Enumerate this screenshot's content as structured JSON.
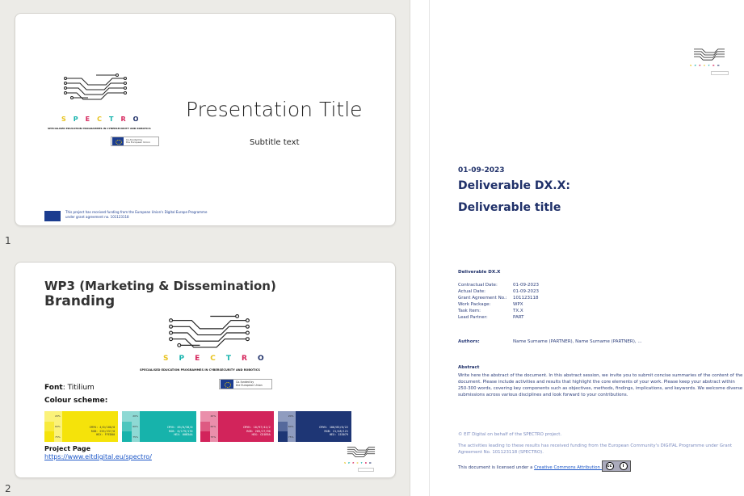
{
  "brand": {
    "letters": [
      {
        "ch": "S",
        "color": "#e8c31e"
      },
      {
        "ch": "P",
        "color": "#16b3ad"
      },
      {
        "ch": "E",
        "color": "#d6265c"
      },
      {
        "ch": "C",
        "color": "#e8c31e"
      },
      {
        "ch": "T",
        "color": "#16b3ad"
      },
      {
        "ch": "R",
        "color": "#d6265c"
      },
      {
        "ch": "O",
        "color": "#1f3069"
      }
    ],
    "tagline": "SPECIALISED EDUCATION PROGRAMMES IN CYBERSECURITY AND ROBOTICS",
    "eu_line1": "Co-funded by",
    "eu_line2": "the European Union"
  },
  "slides": [
    {
      "number": "1",
      "title": "Presentation Title",
      "subtitle": "Subtitle text",
      "footer_line1": "This project has received funding from the European Union's Digital Europe Programme",
      "footer_line2": "under grant agreement no. 101123118"
    },
    {
      "number": "2",
      "title_line1": "WP3 (Marketing & Dissemination)",
      "title_line2": "Branding",
      "font_label": "Font",
      "font_value": ": Titilium",
      "colour_label": "Colour scheme:",
      "swatches": [
        {
          "main": "#f5e30a",
          "tints": [
            "#fbf27a",
            "#f8ea3c",
            "#f5e30a"
          ],
          "text": "#333333",
          "cmyk": "CMYK: 4/0/100/0",
          "rgb": "RGB: 255/237/0",
          "hex": "HEX: FFED00"
        },
        {
          "main": "#17b3ab",
          "tints": [
            "#8ed9d4",
            "#4fc6be",
            "#17b3ab"
          ],
          "text": "#ffffff",
          "cmyk": "CMYK: 85/0/38/0",
          "rgb": "RGB: 0/179/170",
          "hex": "HEX: 00B3AA"
        },
        {
          "main": "#d2245b",
          "tints": [
            "#ea8fab",
            "#de5a82",
            "#d2245b"
          ],
          "text": "#ffffff",
          "cmyk": "CMYK: 10/97/41/2",
          "rgb": "RGB: 205/27/90",
          "hex": "HEX: CD1B5A"
        },
        {
          "main": "#1e3675",
          "tints": [
            "#8f9cbf",
            "#56699c",
            "#1e3675"
          ],
          "text": "#ffffff",
          "cmyk": "CMYK: 100/85/6/22",
          "rgb": "RGB: 21/48/121",
          "hex": "HEX: 153079"
        }
      ],
      "tint_pcts": [
        "20%",
        "60%",
        "75%"
      ],
      "project_label": "Project Page",
      "project_link": "https://www.eitdigital.eu/spectro/"
    }
  ],
  "document": {
    "date": "01-09-2023",
    "title_line1": "Deliverable DX.X:",
    "title_line2": "Deliverable title",
    "deliverable_label": "Deliverable DX.X",
    "meta": [
      {
        "k": "Contractual Date:",
        "v": "01-09-2023"
      },
      {
        "k": "Actual Date:",
        "v": "01-09-2023"
      },
      {
        "k": "Grant Agreement No.:",
        "v": "101123118"
      },
      {
        "k": "Work Package:",
        "v": "WPX"
      },
      {
        "k": "Task Item:",
        "v": "TX.X"
      },
      {
        "k": "Lead Partner:",
        "v": "PART"
      }
    ],
    "authors_label": "Authors:",
    "authors_value": "Name Surname (PARTNER), Name Surname (PARTNER), ...",
    "abstract_heading": "Abstract",
    "abstract_lines": [
      "Write here the abstract of the document. In this abstract session, we invite you to submit concise summaries of the content of the",
      "document. Please include activities and results that highlight the core elements of your work. Please keep your abstract within",
      "250-300 words, covering key components such as objectives, methods, findings, implications, and keywords. We welcome diverse",
      "submissions across various disciplines and look forward to your contributions."
    ],
    "copyright": "© EIT Digital on behalf of the SPECTRO project.",
    "funding_lines": [
      "The activities leading to these results has received funding from the European Community's DIGITAL Programme under Grant",
      "Agreement No. 101123118 (SPECTRO)."
    ],
    "license_prefix": "This document is licensed under a ",
    "license_link": "Creative Commons Attribution 4.0 license",
    "cc_label": "cc",
    "by_label": "i"
  }
}
